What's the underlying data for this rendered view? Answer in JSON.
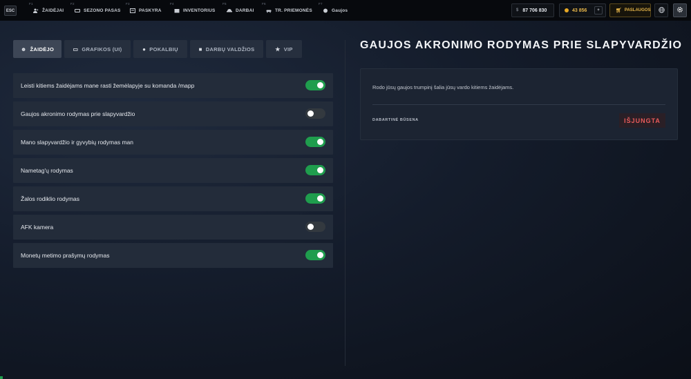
{
  "topbar": {
    "esc": "ESC",
    "nav": [
      {
        "key": "F1",
        "label": "Žaidėjai",
        "icon": "players-icon"
      },
      {
        "key": "F2",
        "label": "Sezono pasas",
        "icon": "pass-icon"
      },
      {
        "key": "F3",
        "label": "Paskyra",
        "icon": "account-icon"
      },
      {
        "key": "F4",
        "label": "Inventorius",
        "icon": "inventory-icon"
      },
      {
        "key": "F5",
        "label": "Darbai",
        "icon": "jobs-icon"
      },
      {
        "key": "F6",
        "label": "Tr. priemonės",
        "icon": "vehicle-icon"
      },
      {
        "key": "F7",
        "label": "Gaujos",
        "icon": "gang-icon"
      }
    ],
    "money_currency": "$",
    "money": "87 706 830",
    "coins": "43 856",
    "coins_plus": "+",
    "shop_label": "PASLAUGOS"
  },
  "tabs": [
    {
      "label": "ŽAIDĖJO",
      "icon": "user-icon",
      "active": true
    },
    {
      "label": "GRAFIKOS (UI)",
      "icon": "monitor-icon",
      "active": false
    },
    {
      "label": "POKALBIŲ",
      "icon": "chat-icon",
      "active": false
    },
    {
      "label": "DARBŲ VALDŽIOS",
      "icon": "briefcase-icon",
      "active": false
    },
    {
      "label": "VIP",
      "icon": "star-icon",
      "active": false
    }
  ],
  "settings": [
    {
      "label": "Leisti kitiems žaidėjams mane rasti žemėlapyje su komanda /mapp",
      "on": true
    },
    {
      "label": "Gaujos akronimo rodymas prie slapyvardžio",
      "on": false
    },
    {
      "label": "Mano slapyvardžio ir gyvybių rodymas man",
      "on": true
    },
    {
      "label": "Nametag'ų rodymas",
      "on": true
    },
    {
      "label": "Žalos rodiklio rodymas",
      "on": true
    },
    {
      "label": "AFK kamera",
      "on": false
    },
    {
      "label": "Monetų metimo prašymų rodymas",
      "on": true
    }
  ],
  "detail": {
    "title": "GAUJOS AKRONIMO RODYMAS PRIE SLAPYVARDŽIO",
    "description": "Rodo jūsų gaujos trumpinį šalia jūsų vardo kitiems žaidėjams.",
    "status_label": "DABARTINĖ BŪSENA",
    "status_value": "IŠJUNGTA"
  },
  "colors": {
    "toggle_on": "#1f9d4d",
    "status_off": "#ea5b5b",
    "coins": "#e7b64a"
  }
}
